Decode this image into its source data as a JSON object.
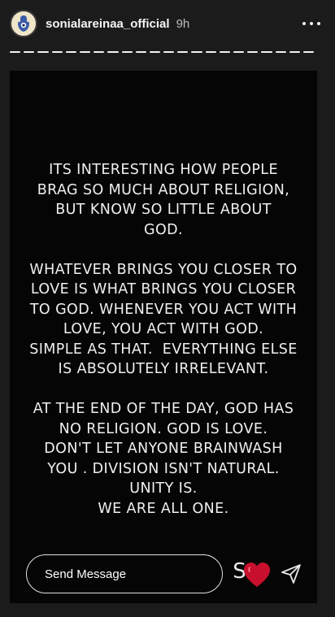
{
  "header": {
    "username": "sonialareinaa_official",
    "timestamp": "9h",
    "avatar_icon": "hamsa-hand-icon",
    "more_icon": "more-options-icon"
  },
  "progress": {
    "segments": 22,
    "filled": 22
  },
  "story": {
    "paragraphs": [
      [
        "ITS INTERESTING HOW PEOPLE",
        "BRAG SO MUCH ABOUT RELIGION,",
        "BUT KNOW SO LITTLE ABOUT",
        "GOD."
      ],
      [
        "WHATEVER BRINGS YOU CLOSER TO",
        "LOVE IS WHAT BRINGS YOU CLOSER",
        "TO GOD. WHENEVER YOU ACT WITH",
        "LOVE, YOU ACT WITH GOD.",
        "SIMPLE AS THAT.  EVERYTHING ELSE",
        "IS ABSOLUTELY IRRELEVANT."
      ],
      [
        "AT THE END OF THE DAY, GOD HAS",
        "NO RELIGION. GOD IS LOVE.",
        "DON'T LET ANYONE BRAINWASH",
        "YOU . DIVISION ISN'T NATURAL.",
        "UNITY IS.",
        "WE ARE ALL ONE."
      ]
    ]
  },
  "footer": {
    "send_placeholder": "Send Message",
    "sticker_letter": "S",
    "sticker_icon": "heart-sticker-icon",
    "send_icon": "paper-plane-icon"
  },
  "colors": {
    "background": "#1b1b1b",
    "story_bg": "#050505",
    "heart": "#c8102e"
  }
}
